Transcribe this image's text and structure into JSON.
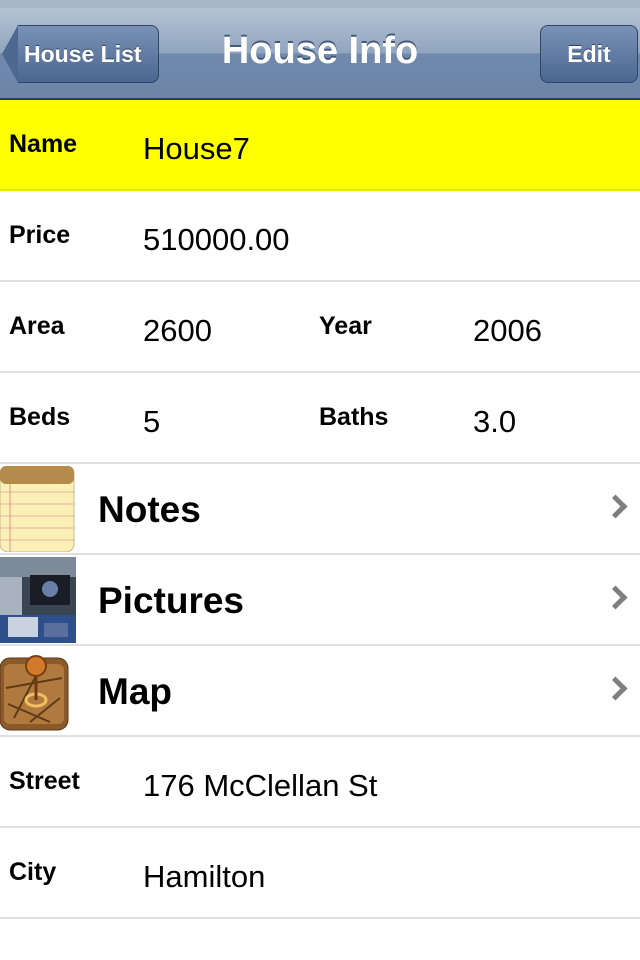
{
  "navbar": {
    "back_label": "House List",
    "title": "House Info",
    "edit_label": "Edit"
  },
  "fields": {
    "name": {
      "label": "Name",
      "value": "House7"
    },
    "price": {
      "label": "Price",
      "value": "510000.00"
    },
    "area": {
      "label": "Area",
      "value": "2600"
    },
    "year": {
      "label": "Year",
      "value": "2006"
    },
    "beds": {
      "label": "Beds",
      "value": "5"
    },
    "baths": {
      "label": "Baths",
      "value": "3.0"
    },
    "street": {
      "label": "Street",
      "value": "176 McClellan St"
    },
    "city": {
      "label": "City",
      "value": "Hamilton"
    }
  },
  "links": {
    "notes": {
      "label": "Notes",
      "icon": "notepad-icon"
    },
    "pictures": {
      "label": "Pictures",
      "icon": "photo-thumbnail"
    },
    "map": {
      "label": "Map",
      "icon": "map-pin-icon"
    }
  },
  "colors": {
    "highlight": "#ffff00",
    "navbar": "#6d84a6"
  }
}
